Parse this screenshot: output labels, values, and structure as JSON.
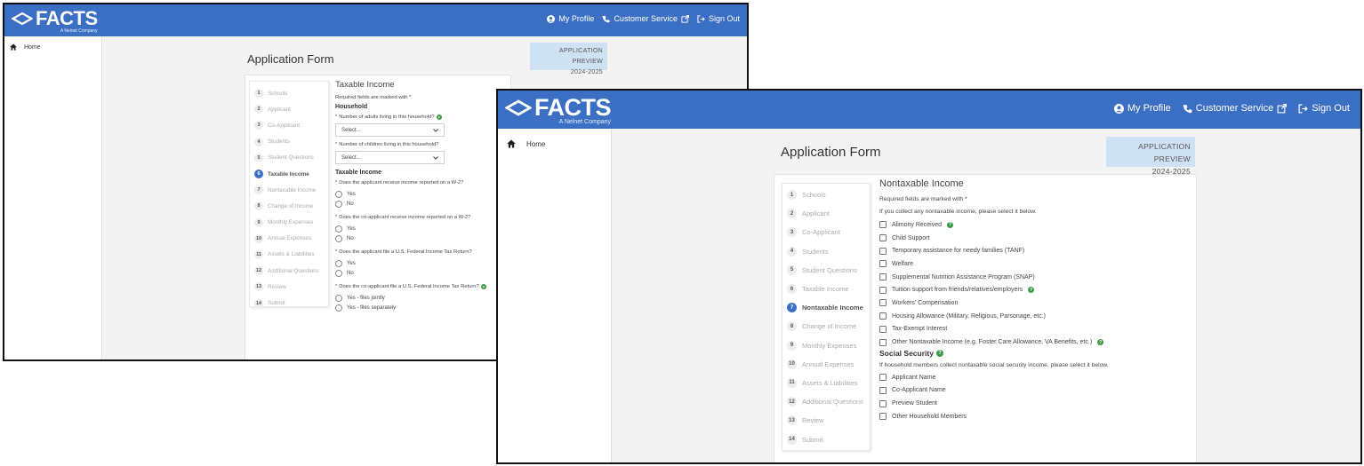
{
  "brand": {
    "logo_text": "FACTS",
    "logo_sub": "A Nelnet Company"
  },
  "header_nav": {
    "profile": "My Profile",
    "customer_service": "Customer Service",
    "sign_out": "Sign Out"
  },
  "sidebar": {
    "home": "Home"
  },
  "page": {
    "title": "Application Form",
    "preview_label": "APPLICATION PREVIEW",
    "preview_year": "2024-2025"
  },
  "steps": [
    {
      "num": "1",
      "label": "Schools"
    },
    {
      "num": "2",
      "label": "Applicant"
    },
    {
      "num": "3",
      "label": "Co-Applicant"
    },
    {
      "num": "4",
      "label": "Students"
    },
    {
      "num": "5",
      "label": "Student Questions"
    },
    {
      "num": "6",
      "label": "Taxable Income"
    },
    {
      "num": "7",
      "label": "Nontaxable Income"
    },
    {
      "num": "8",
      "label": "Change of Income"
    },
    {
      "num": "9",
      "label": "Monthly Expenses"
    },
    {
      "num": "10",
      "label": "Annual Expenses"
    },
    {
      "num": "11",
      "label": "Assets & Liabilities"
    },
    {
      "num": "12",
      "label": "Additional Questions"
    },
    {
      "num": "13",
      "label": "Review"
    },
    {
      "num": "14",
      "label": "Submit"
    }
  ],
  "taxable": {
    "title": "Taxable Income",
    "required_note": "Required fields are marked with *",
    "household_heading": "Household",
    "q_adults": "Number of adults living in this household?",
    "q_children": "Number of children living in this household?",
    "select_placeholder": "Select...",
    "taxable_heading": "Taxable Income",
    "q_applicant_w2": "Does the applicant receive income reported on a W-2?",
    "q_coapplicant_w2": "Does the co-applicant receive income reported on a W-2?",
    "q_applicant_return": "Does the applicant file a U.S. Federal Income Tax Return?",
    "q_coapplicant_return": "Does the co-applicant file a U.S. Federal Income Tax Return?",
    "yes": "Yes",
    "no": "No",
    "yes_jointly": "Yes - files jointly",
    "yes_separately": "Yes - files separately"
  },
  "nontaxable": {
    "title": "Nontaxable Income",
    "required_note": "Required fields are marked with *",
    "intro": "If you collect any nontaxable income, please select it below.",
    "options": [
      "Alimony Received",
      "Child Support",
      "Temporary assistance for needy families (TANF)",
      "Welfare",
      "Supplemental Nutrition Assistance Program (SNAP)",
      "Tuition support from friends/relatives/employers",
      "Workers' Compensation",
      "Housing Allowance (Military, Religious, Parsonage, etc.)",
      "Tax-Exempt Interest",
      "Other Nontaxable Income (e.g. Foster Care Allowance, VA Benefits, etc.)"
    ],
    "ss_heading": "Social Security",
    "ss_intro": "If household members collect nontaxable social security income, please select it below.",
    "ss_options": [
      "Applicant Name",
      "Co-Applicant Name",
      "Preview Student",
      "Other Household Members"
    ]
  },
  "colors": {
    "brand_blue": "#3b6fc3",
    "preview_bg": "#cfe2f3",
    "help_green": "#3d9a45",
    "active_step": "#3b6fc3"
  }
}
